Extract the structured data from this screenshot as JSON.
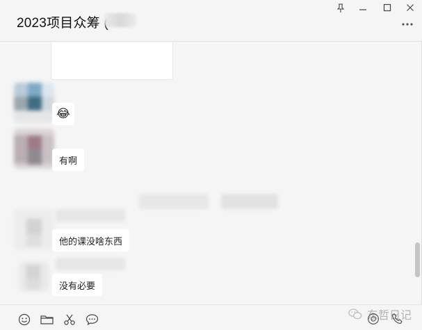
{
  "window": {
    "chat_title": "2023项目众筹 (",
    "controls": [
      "pin-icon",
      "minimize-icon",
      "maximize-icon",
      "close-icon"
    ],
    "more_icon": "more-dots-icon"
  },
  "messages": [
    {
      "type": "emoji",
      "emoji": "😂"
    },
    {
      "type": "text",
      "text": "有啊"
    },
    {
      "type": "text",
      "text": "他的课没啥东西"
    },
    {
      "type": "text",
      "text": "没有必要"
    }
  ],
  "toolbar": {
    "icons": [
      "emoji-icon",
      "folder-icon",
      "scissors-icon",
      "chat-bubble-icon",
      "video-call-icon",
      "phone-icon"
    ]
  },
  "watermark": {
    "text": "东哲日记"
  }
}
